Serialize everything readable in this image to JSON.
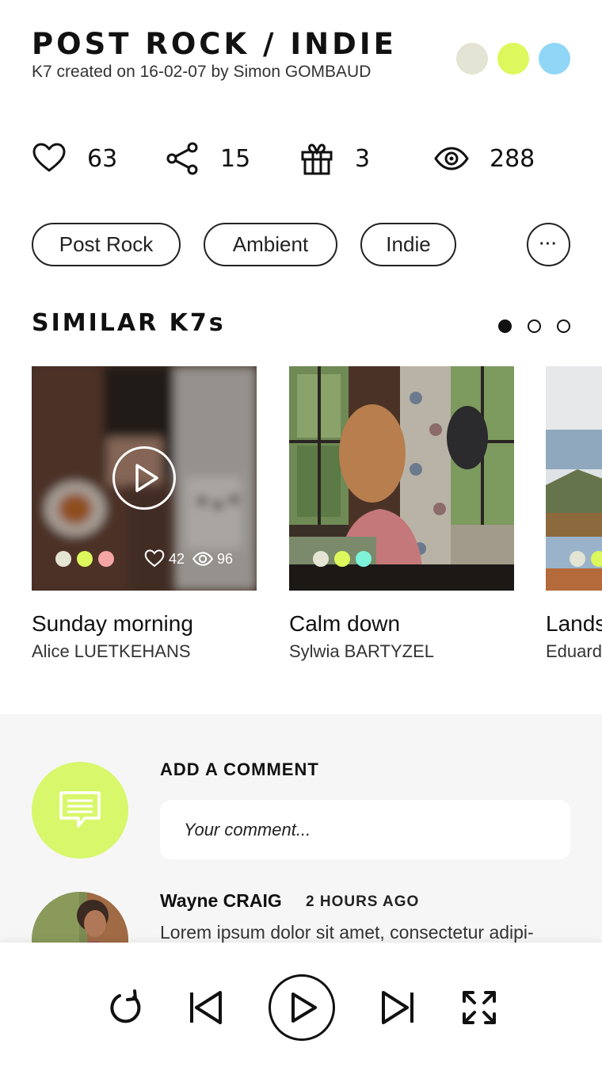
{
  "header": {
    "title": "POST ROCK / INDIE",
    "subtitle": "K7 created on 16-02-07 by Simon GOMBAUD",
    "swatches": [
      "#e3e4d4",
      "#dcf85c",
      "#8fd6f7"
    ]
  },
  "stats": {
    "likes": "63",
    "shares": "15",
    "gifts": "3",
    "views": "288"
  },
  "tags": [
    "Post Rock",
    "Ambient",
    "Indie"
  ],
  "tags_more_label": "···",
  "similar": {
    "title": "SIMILAR K7s",
    "pager_total": 3,
    "pager_active": 0,
    "cards": [
      {
        "title": "Sunday morning",
        "author": "Alice LUETKEHANS",
        "swatches": [
          "#e3e4d4",
          "#dcf85c",
          "#f6a5a5"
        ],
        "likes": "42",
        "views": "96"
      },
      {
        "title": "Calm down",
        "author": "Sylwia BARTYZEL",
        "swatches": [
          "#e3e4d4",
          "#dcf85c",
          "#7ef2d8"
        ]
      },
      {
        "title": "Landscape",
        "author": "Eduardo",
        "swatches": [
          "#e3e4d4",
          "#dcf85c"
        ]
      }
    ]
  },
  "comments": {
    "add_label": "ADD A COMMENT",
    "placeholder": "Your comment...",
    "items": [
      {
        "author": "Wayne CRAIG",
        "time": "2 HOURS AGO",
        "text": "Lorem ipsum dolor sit amet, consectetur adipi-"
      }
    ]
  },
  "colors": {
    "accent": "#d9f76b",
    "text": "#111111"
  }
}
